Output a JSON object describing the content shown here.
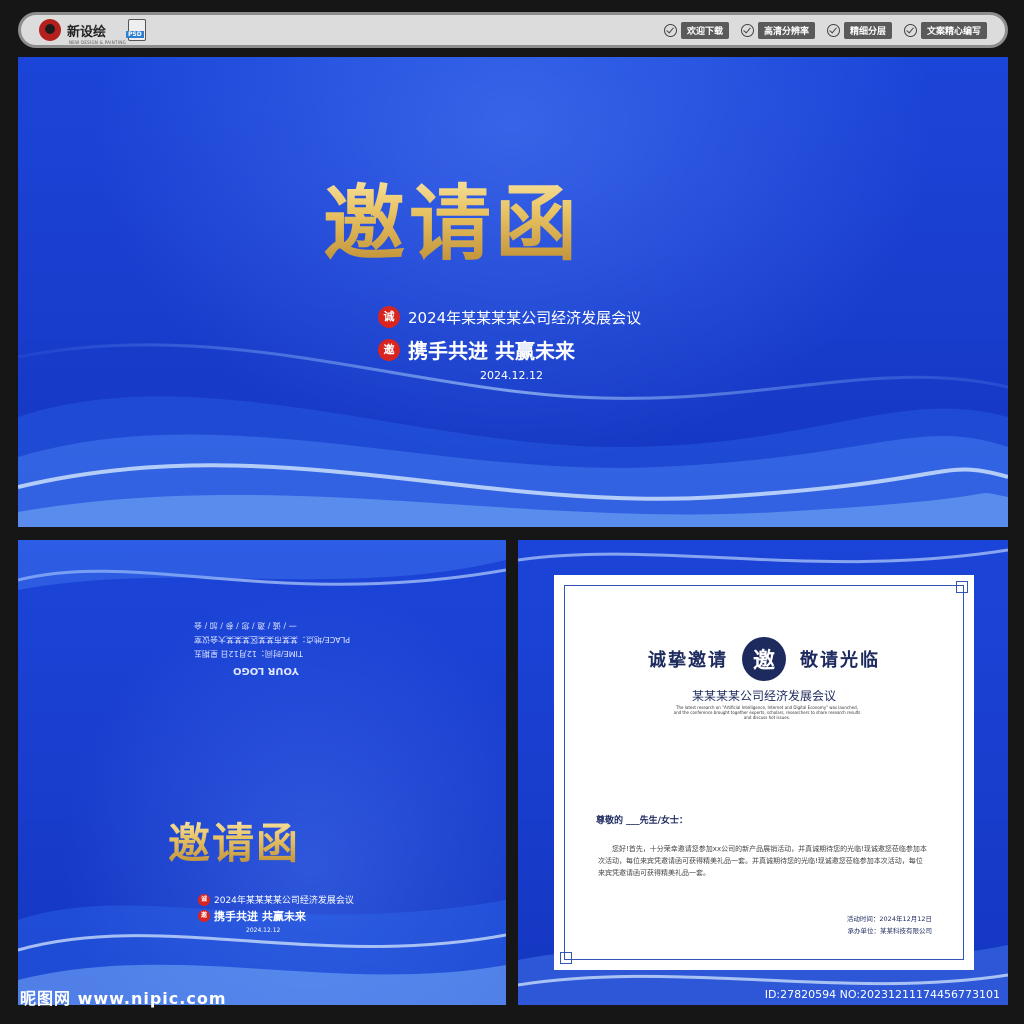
{
  "header": {
    "brand_name": "新设绘",
    "brand_sub": "NEW DESIGN & PAINTING",
    "psd_label": "PSD",
    "features": [
      "欢迎下载",
      "高清分辨率",
      "精细分层",
      "文案精心编写"
    ]
  },
  "cover": {
    "title": "邀请函",
    "subtitle": "2024年某某某某公司经济发展会议",
    "slogan": "携手共进 共赢未来",
    "date": "2024.12.12",
    "seals": [
      "诚",
      "邀"
    ]
  },
  "back_cover": {
    "lines": [
      "YOUR LOGO",
      "TIME/时间：12月12日 星期五",
      "PLACE/地点：某某市某某区某某某大会议室",
      "一 / 诚 / 邀 / 您 / 参 / 加 / 会"
    ],
    "title": "邀请函",
    "subtitle": "2024年某某某某公司经济发展会议",
    "slogan": "携手共进 共赢未来",
    "date": "2024.12.12",
    "seals": [
      "诚",
      "邀"
    ]
  },
  "letter": {
    "header_left": "诚挚邀请",
    "header_seal": "邀",
    "header_right": "敬请光临",
    "meeting_name": "某某某某公司经济发展会议",
    "english_text": "The latest research on \"Artificial Intelligence, Internet and Digital Economy\" was launched, and the conference brought together experts, scholars, researchers to share research results and discuss hot issues.",
    "greeting": "尊敬的 ___先生/女士：",
    "body": "您好!首先，十分荣幸邀请您参加xx公司的新产品展销活动，并真诚期待您的光临!现诚邀您莅临参加本次活动，每位来宾凭邀请函可获得精美礼品一套。并真诚期待您的光临!现诚邀您莅临参加本次活动，每位来宾凭邀请函可获得精美礼品一套。",
    "time_line": "活动时间：2024年12月12日",
    "org_line": "承办单位：某某科技有限公司"
  },
  "footer": {
    "site": "昵图网 www.nipic.com",
    "id_text": "ID:27820594 NO:20231211174456773101"
  },
  "colors": {
    "panel_blue": "#1b45d8",
    "gold": "#e9c465",
    "seal_red": "#d8251f",
    "navy": "#1d2a5e",
    "frame_blue": "#3554b8"
  }
}
